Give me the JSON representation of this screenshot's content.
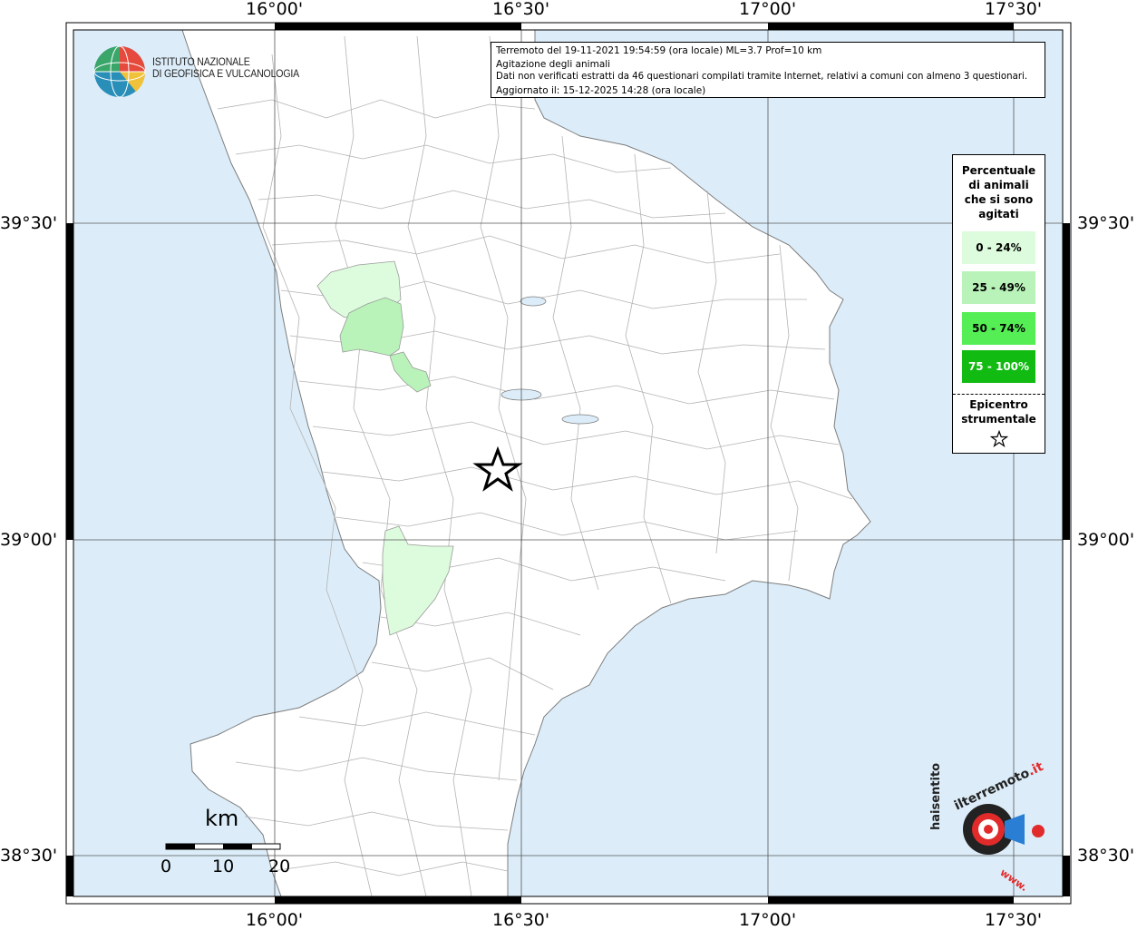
{
  "map": {
    "colors": {
      "sea": "#dcedf9",
      "land": "#ffffff",
      "borders": "#9a9a9a",
      "grid": "#555555",
      "frame": "#000000",
      "class1": "#ddfbdd",
      "class2": "#b9f3b9",
      "class3": "#55ee55",
      "class4": "#11bb11"
    },
    "lon_ticks": [
      "16°00'",
      "16°30'",
      "17°00'",
      "17°30'"
    ],
    "lat_ticks": [
      "39°30'",
      "39°00'",
      "38°30'"
    ]
  },
  "info": {
    "line1": "Terremoto del 19-11-2021 19:54:59 (ora locale) ML=3.7 Prof=10 km",
    "line2": "Agitazione degli animali",
    "line3": "Dati non verificati estratti da 46 questionari compilati tramite Internet, relativi a comuni con almeno 3 questionari.",
    "line4": "Aggiornato il: 15-12-2025 14:28 (ora locale)"
  },
  "legend": {
    "title_lines": [
      "Percentuale",
      "di animali",
      "che si sono",
      "agitati"
    ],
    "items": [
      {
        "label": "0 - 24%",
        "color": "#ddfbdd",
        "text_color": "#000000"
      },
      {
        "label": "25 - 49%",
        "color": "#b9f3b9",
        "text_color": "#000000"
      },
      {
        "label": "50 - 74%",
        "color": "#55ee55",
        "text_color": "#000000"
      },
      {
        "label": "75 - 100%",
        "color": "#11bb11",
        "text_color": "#ffffff"
      }
    ],
    "epicenter_lines": [
      "Epicentro",
      "strumentale"
    ],
    "epicenter_icon": "star-icon"
  },
  "logo_ingv": {
    "line1": "ISTITUTO NAZIONALE",
    "line2": "DI GEOFISICA E VULCANOLOGIA",
    "icon": "globe-icon"
  },
  "logo_hsit": {
    "text_a": "haisentito",
    "text_b": "ilterremoto",
    "text_c": ".it",
    "text_d": "www.",
    "icon": "speaker-target-icon"
  },
  "scale": {
    "title": "km",
    "labels": [
      "0",
      "10",
      "20"
    ]
  }
}
